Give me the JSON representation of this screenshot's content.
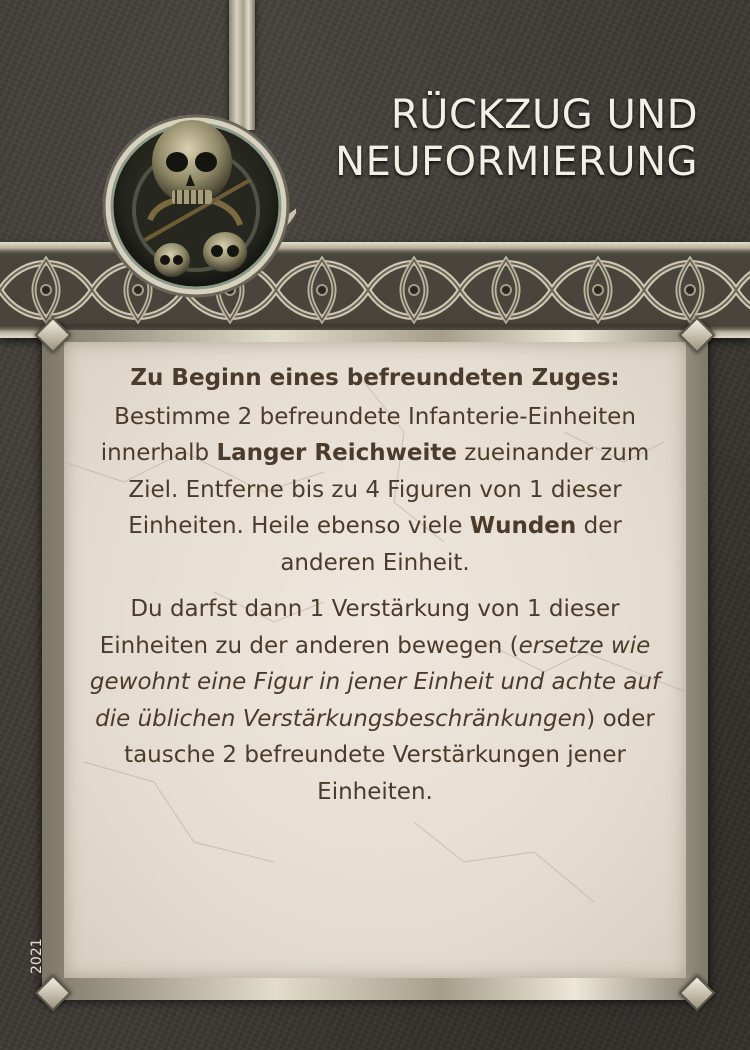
{
  "card": {
    "title_line1": "RÜCKZUG UND",
    "title_line2": "NEUFORMIERUNG",
    "emblem_icon": "skull-emblem-icon",
    "trigger": "Zu Beginn eines befreundeten Zuges:",
    "p1": {
      "a": "Bestimme 2 befreundete Infanterie-Einheiten innerhalb ",
      "b1": "Langer Reichweite",
      "c": " zueinander zum Ziel. Entferne bis zu 4 Figuren von 1 dieser Einheiten. Heile ebenso viele ",
      "b2": "Wunden",
      "d": " der anderen Einheit."
    },
    "p2": {
      "a": "Du darfst dann 1 Verstärkung von 1 dieser Einheiten zu der anderen bewegen (",
      "italic": "ersetze wie gewohnt eine Figur in jener Einheit und achte auf die üblichen Verstärkungsbeschränkungen",
      "b": ") oder tausche 2 befreundete Verstärkungen jener Einheiten."
    },
    "year": "2021"
  },
  "colors": {
    "background": "#3d3934",
    "parchment": "#e9e1d6",
    "text": "#4b3b2a",
    "title": "#f4efe4",
    "frame": "#d8d2bf"
  }
}
